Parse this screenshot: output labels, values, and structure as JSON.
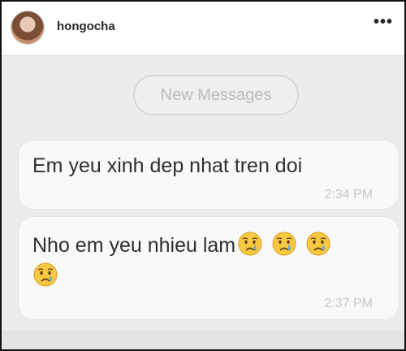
{
  "post": {
    "username": "hongocha",
    "more_icon": "•••"
  },
  "chat": {
    "new_messages_label": "New Messages",
    "messages": [
      {
        "text": "Em yeu xinh dep nhat tren doi",
        "time": "2:34 PM"
      },
      {
        "text": "Nho em yeu nhieu lam",
        "time": "2:37 PM",
        "emoji": "crying-face-icon",
        "emoji_count": 4
      }
    ]
  },
  "colors": {
    "background": "#ebebeb",
    "bubble": "#f9f9f9",
    "text": "#2f2f2f",
    "timestamp": "#c8c8c8"
  }
}
